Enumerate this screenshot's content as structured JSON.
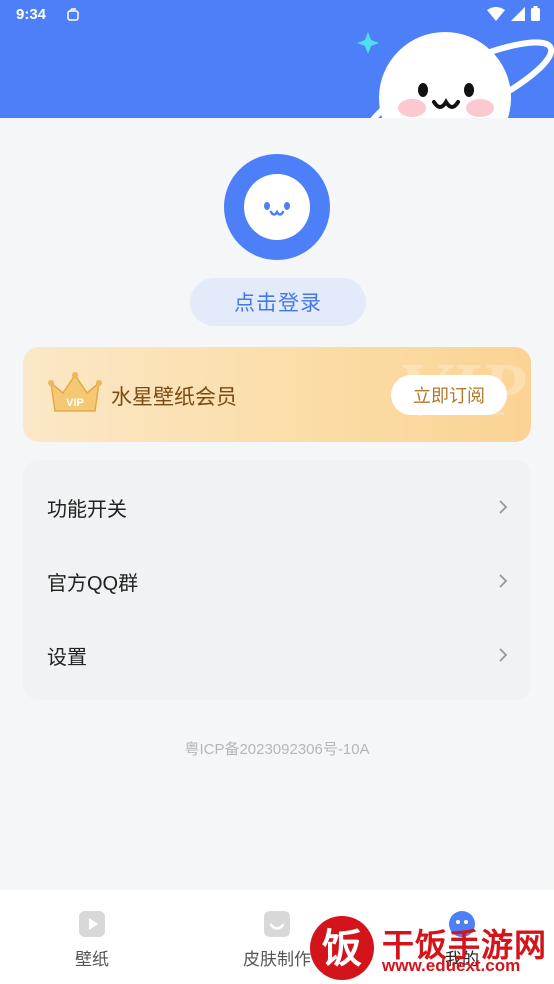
{
  "status_bar": {
    "time": "9:34"
  },
  "profile": {
    "login_label": "点击登录"
  },
  "vip": {
    "title": "水星壁纸会员",
    "subscribe_label": "立即订阅",
    "badge_text": "VIP",
    "watermark": "VIP"
  },
  "menu": {
    "items": [
      {
        "label": "功能开关"
      },
      {
        "label": "官方QQ群"
      },
      {
        "label": "设置"
      }
    ]
  },
  "footer": {
    "icp": "粤ICP备2023092306号-10A"
  },
  "tabs": [
    {
      "label": "壁纸",
      "icon": "play-square-icon"
    },
    {
      "label": "皮肤制作",
      "icon": "face-square-icon"
    },
    {
      "label": "我的",
      "icon": "mascot-face-icon",
      "active": true
    }
  ],
  "watermark_overlay": {
    "brand_char": "饭",
    "title": "干饭手游网",
    "url": "www.eduext.com"
  },
  "colors": {
    "primary": "#4d80f8",
    "vip_text": "#7a4c13",
    "watermark_red": "#d4141b"
  }
}
